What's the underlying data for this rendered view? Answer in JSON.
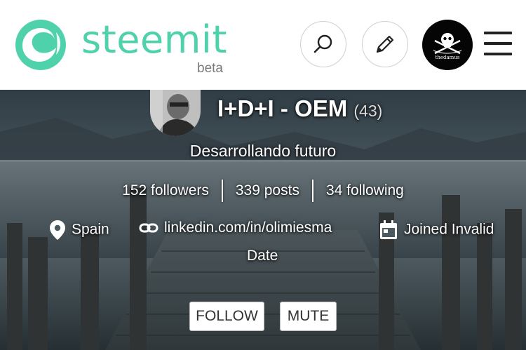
{
  "header": {
    "logo_text": "steemit",
    "logo_badge": "beta",
    "search_icon": "search-icon",
    "compose_icon": "pencil-icon",
    "user_avatar_text": "thedamus",
    "menu_icon": "hamburger-icon",
    "brand_color": "#4fd1ab"
  },
  "profile": {
    "name": "I+D+I - OEM",
    "reputation": "(43)",
    "about": "Desarrollando futuro",
    "stats": {
      "followers": "152 followers",
      "posts": "339 posts",
      "following": "34 following"
    },
    "location": "Spain",
    "website": "linkedin.com/in/olimiesma",
    "joined_line1": "Joined Invalid",
    "joined_line2": "Date",
    "icons": {
      "location": "location-pin-icon",
      "website": "link-icon",
      "joined": "calendar-icon"
    }
  },
  "actions": {
    "follow_label": "FOLLOW",
    "mute_label": "MUTE"
  }
}
